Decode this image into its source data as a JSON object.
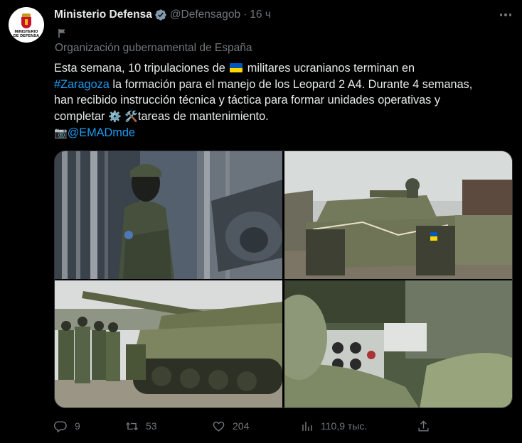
{
  "account": {
    "name": "Ministerio Defensa",
    "handle": "@Defensagob",
    "separator": "·",
    "time": "16 ч",
    "affiliation": "Organización gubernamental de España",
    "avatar_text_line1": "MINISTERIO",
    "avatar_text_line2": "DE DEFENSA"
  },
  "text": {
    "line1_a": "Esta semana, 10 tripulaciones de ",
    "line1_b": " militares ucranianos terminan en",
    "line2_link": "#Zaragoza",
    "line2_rest": " la formación para el manejo de los Leopard 2 A4. Durante 4 semanas,",
    "line3": "han recibido instrucción técnica y táctica para formar unidades operativas y",
    "line4_a": "completar ",
    "line4_gear": "⚙️",
    "line4_tools": "🛠️",
    "line4_b": "tareas de mantenimiento.",
    "line5_camera": "📷",
    "line5_link": "@EMADmde"
  },
  "actions": {
    "replies": "9",
    "retweets": "53",
    "likes": "204",
    "views": "110,9 тыс."
  },
  "colors": {
    "background": "#000000",
    "text": "#e7e9ea",
    "muted": "#71767b",
    "link": "#1d9bf0",
    "verified": "#829aab",
    "flag_blue": "#0057b7",
    "flag_yellow": "#ffd700"
  },
  "icons": {
    "verified": "verified-badge-icon",
    "affiliation": "flag-icon",
    "more": "more-icon",
    "reply": "reply-icon",
    "retweet": "retweet-icon",
    "like": "heart-icon",
    "views": "views-icon",
    "share": "share-icon"
  }
}
